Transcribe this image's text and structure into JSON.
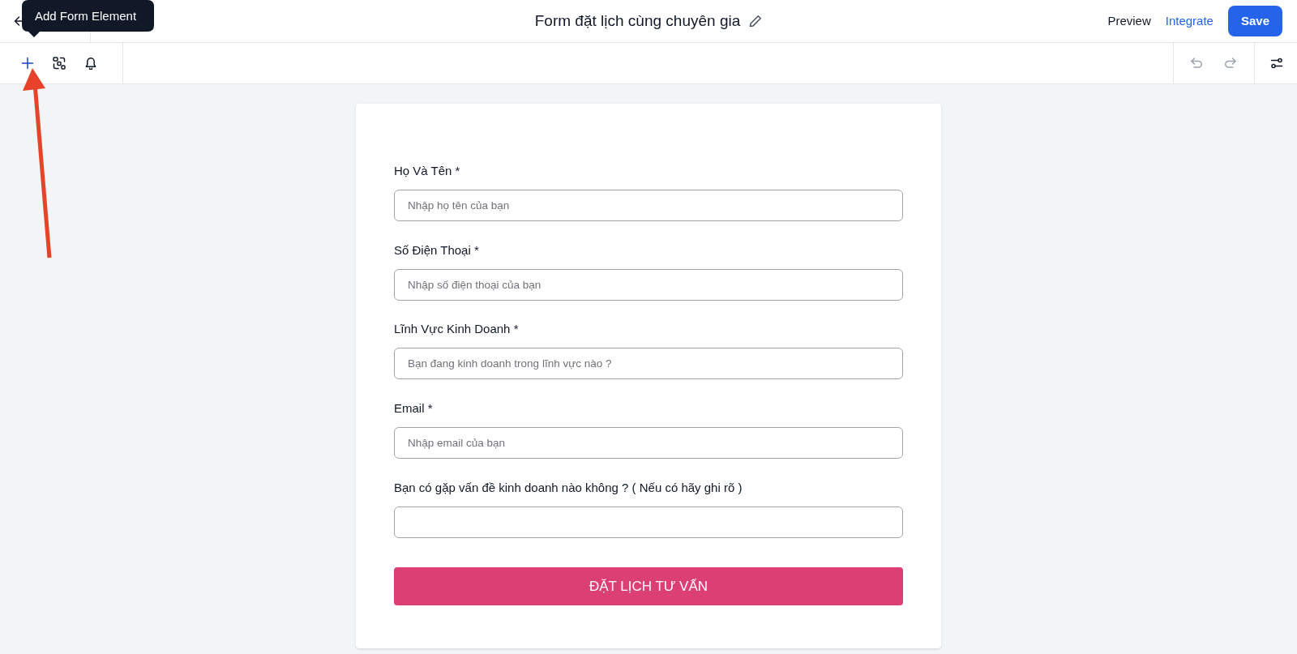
{
  "header": {
    "title": "Form đặt lịch cùng chuyên gia",
    "actions": [
      {
        "kind": "preview",
        "label": "Preview"
      },
      {
        "kind": "integrate",
        "label": "Integrate"
      },
      {
        "kind": "save",
        "label": "Save"
      }
    ]
  },
  "toolbar": {
    "tools": [
      {
        "kind": "add",
        "selected": true
      },
      {
        "kind": "logic",
        "selected": false
      },
      {
        "kind": "notifications",
        "selected": false
      }
    ],
    "history": [
      {
        "kind": "undo",
        "disabled": true
      },
      {
        "kind": "redo",
        "disabled": true
      }
    ]
  },
  "tooltip": {
    "text": "Add Form Element"
  },
  "form": {
    "fields": [
      {
        "label": "Họ Và Tên *",
        "placeholder": "Nhập họ tên của bạn"
      },
      {
        "label": "Số Điện Thoại *",
        "placeholder": "Nhập số điện thoại của bạn"
      },
      {
        "label": "Lĩnh Vực Kinh Doanh *",
        "placeholder": "Bạn đang kinh doanh trong lĩnh vực nào ?"
      },
      {
        "label": "Email *",
        "placeholder": "Nhập email của bạn"
      },
      {
        "label": "Bạn có gặp vấn đề kinh doanh nào không ? ( Nếu có hãy ghi rõ )"
      }
    ],
    "submit": {
      "label": "ĐẶT LỊCH TƯ VẤN"
    }
  }
}
